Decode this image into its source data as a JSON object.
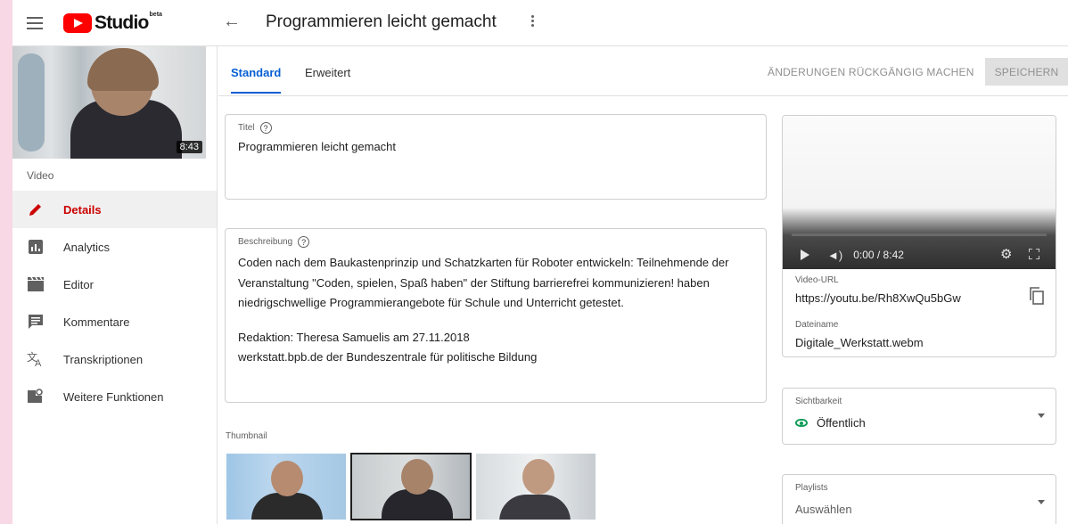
{
  "header": {
    "logo_text": "Studio",
    "logo_badge": "beta",
    "page_title": "Programmieren leicht gemacht"
  },
  "sidebar": {
    "thumbnail_duration": "8:43",
    "section_label": "Video",
    "items": [
      {
        "label": "Details",
        "icon": "pencil-icon",
        "active": true
      },
      {
        "label": "Analytics",
        "icon": "analytics-icon",
        "active": false
      },
      {
        "label": "Editor",
        "icon": "clapperboard-icon",
        "active": false
      },
      {
        "label": "Kommentare",
        "icon": "comment-icon",
        "active": false
      },
      {
        "label": "Transkriptionen",
        "icon": "translate-icon",
        "active": false
      },
      {
        "label": "Weitere Funktionen",
        "icon": "more-features-icon",
        "active": false
      }
    ]
  },
  "tabs": {
    "standard": "Standard",
    "erweitert": "Erweitert"
  },
  "actions": {
    "undo_label": "ÄNDERUNGEN RÜCKGÄNGIG MACHEN",
    "save_label": "SPEICHERN"
  },
  "form": {
    "title_label": "Titel",
    "title_value": "Programmieren leicht gemacht",
    "description_label": "Beschreibung",
    "description_lines": [
      "Coden nach dem Baukastenprinzip und Schatzkarten für Roboter entwickeln: Teilnehmende der",
      "Veranstaltung \"Coden, spielen, Spaß haben\" der Stiftung barrierefrei kommunizieren! haben",
      "niedrigschwellige Programmierangebote für Schule und Unterricht getestet.",
      "",
      "Redaktion: Theresa Samuelis am 27.11.2018",
      "werkstatt.bpb.de der Bundeszentrale für politische Bildung"
    ],
    "thumbnail_label": "Thumbnail",
    "help_glyph": "?"
  },
  "player": {
    "time": "0:00 / 8:42",
    "video_url_label": "Video-URL",
    "video_url": "https://youtu.be/Rh8XwQu5bGw",
    "filename_label": "Dateiname",
    "filename": "Digitale_Werkstatt.webm"
  },
  "visibility": {
    "label": "Sichtbarkeit",
    "value": "Öffentlich"
  },
  "playlists": {
    "label": "Playlists",
    "placeholder": "Auswählen"
  },
  "colors": {
    "accent": "#065fd4",
    "active_nav": "#cc0000",
    "brand": "#ff0000",
    "public_green": "#0f9d58"
  }
}
